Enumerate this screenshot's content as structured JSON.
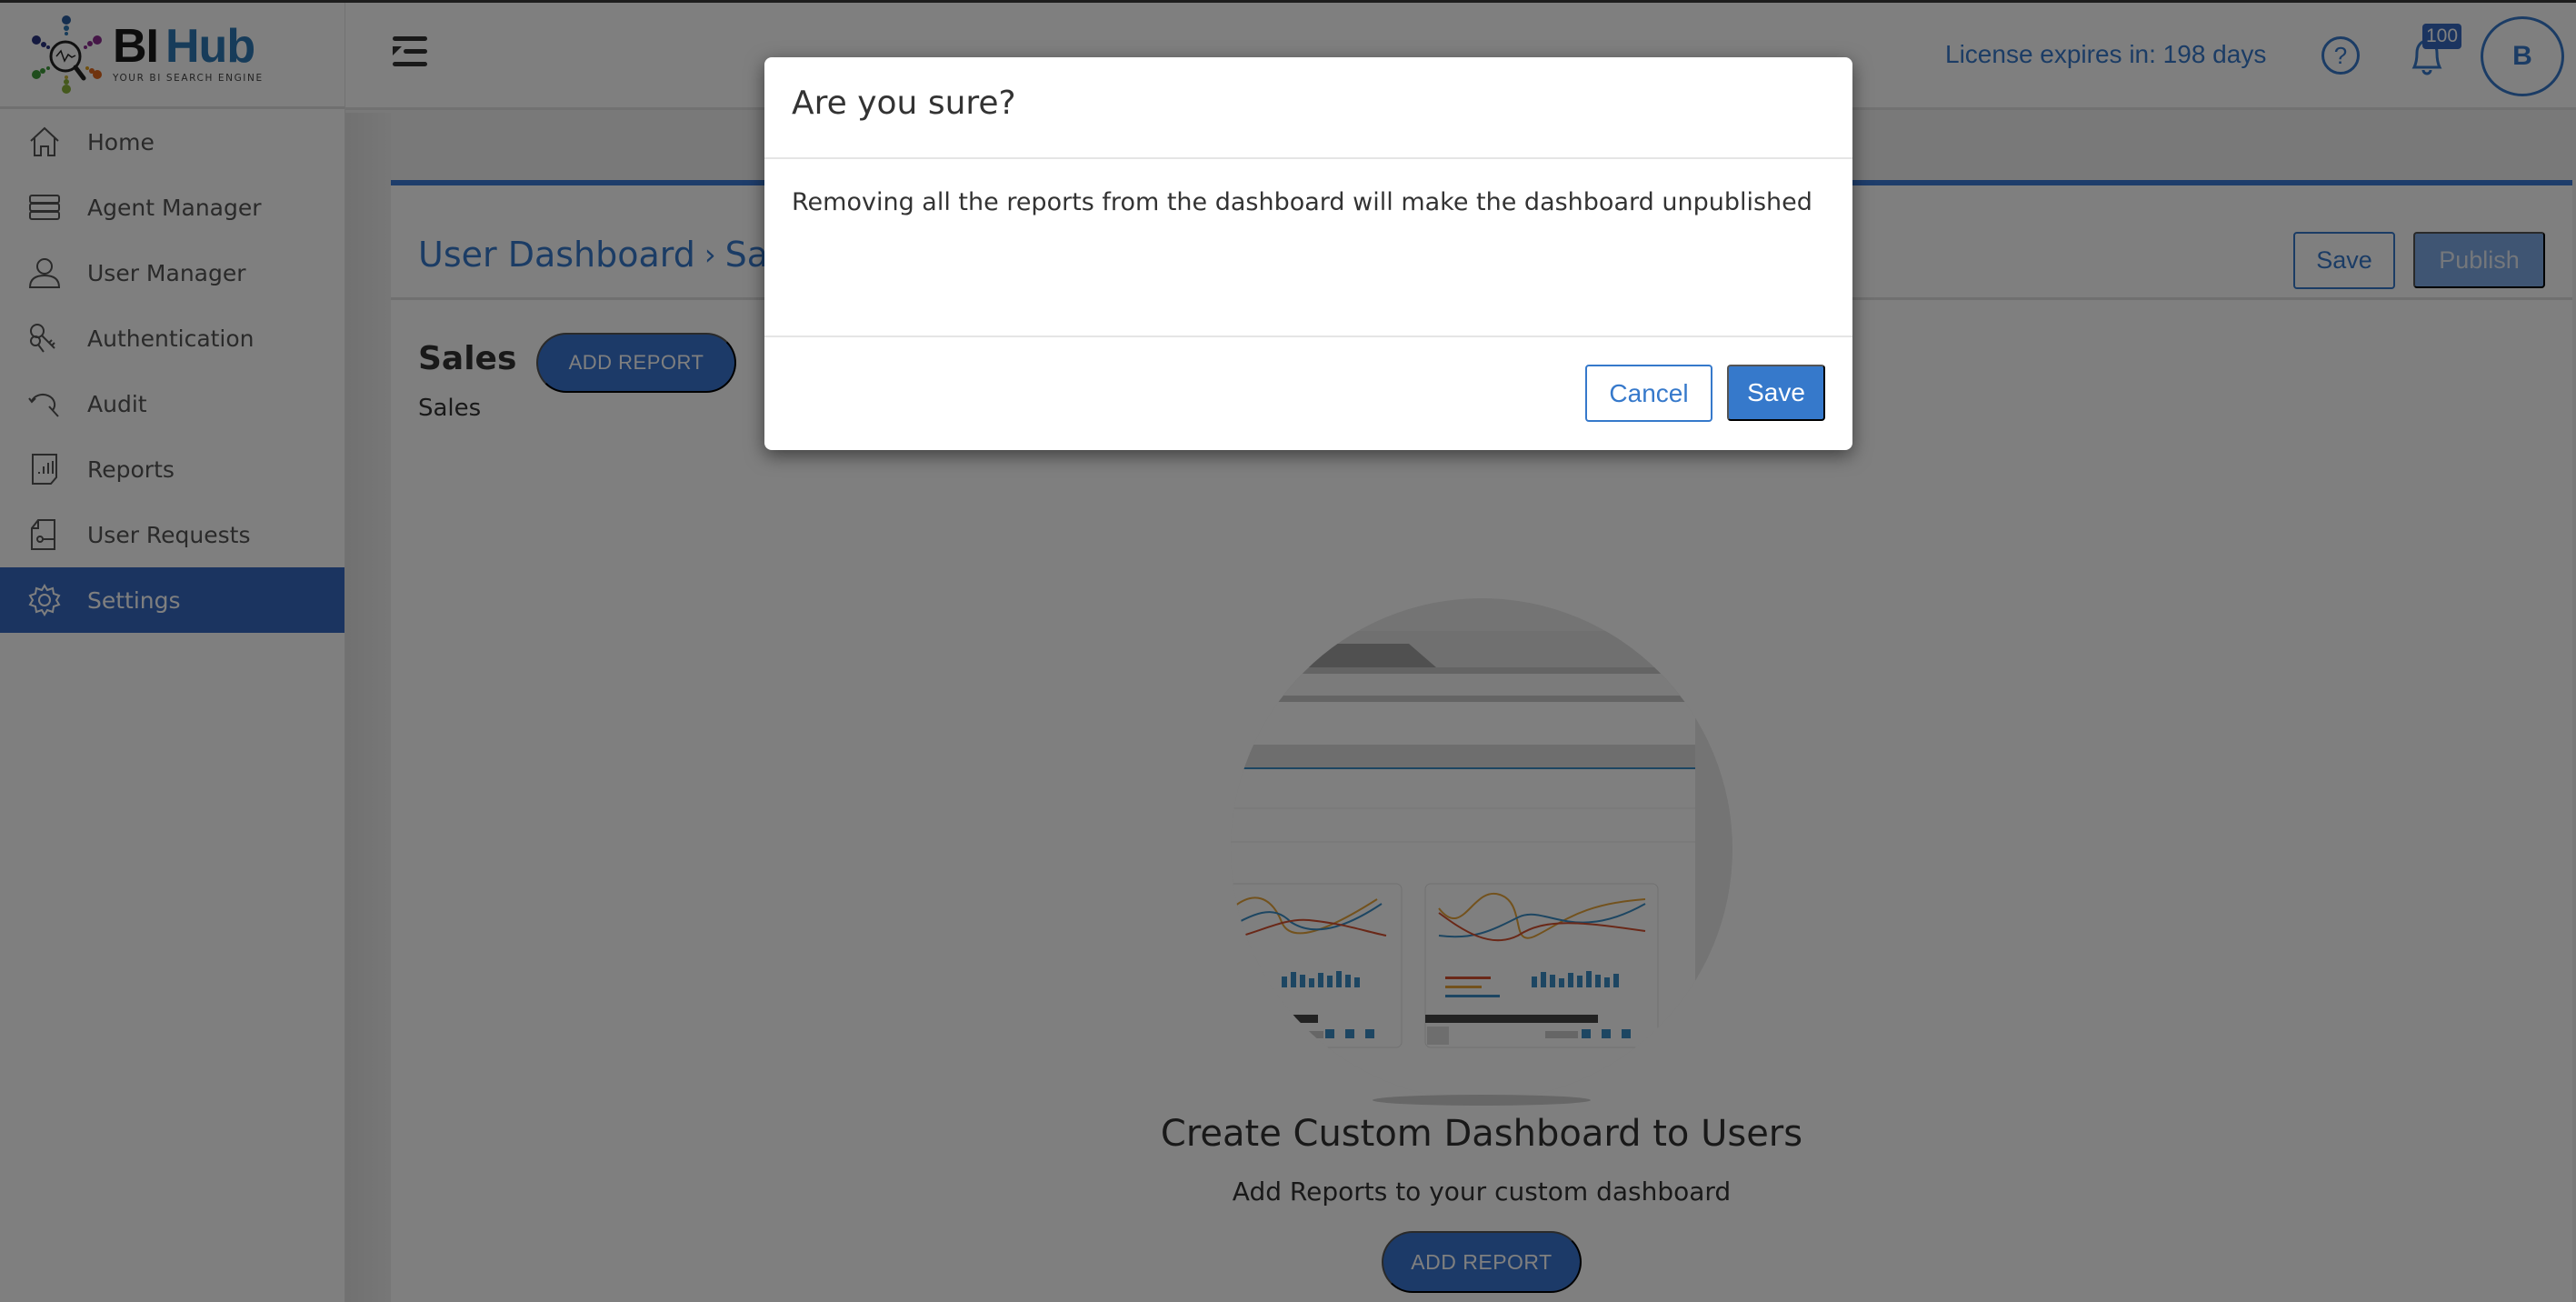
{
  "app": {
    "logo_main_left": "BI",
    "logo_main_right": "Hub",
    "logo_tagline": "YOUR BI SEARCH ENGINE"
  },
  "colors": {
    "primary": "#3679cb",
    "sidebar_active": "#3769c0",
    "overlay": "rgba(0,0,0,0.5)"
  },
  "sidebar": {
    "items": [
      {
        "label": "Home",
        "icon": "home-icon",
        "active": false
      },
      {
        "label": "Agent Manager",
        "icon": "server-icon",
        "active": false
      },
      {
        "label": "User Manager",
        "icon": "user-icon",
        "active": false
      },
      {
        "label": "Authentication",
        "icon": "keys-icon",
        "active": false
      },
      {
        "label": "Audit",
        "icon": "audit-search-icon",
        "active": false
      },
      {
        "label": "Reports",
        "icon": "report-chart-icon",
        "active": false
      },
      {
        "label": "User Requests",
        "icon": "request-key-icon",
        "active": false
      },
      {
        "label": "Settings",
        "icon": "gear-icon",
        "active": true
      }
    ]
  },
  "header": {
    "menu_icon": "menu-collapse-icon",
    "license_text": "License expires in: 198 days",
    "help_icon": "?",
    "notification_count": "100",
    "avatar_initial": "B"
  },
  "main": {
    "breadcrumb": {
      "parent": "User Dashboard",
      "separator": "›",
      "current": "Sales"
    },
    "save_label": "Save",
    "publish_label": "Publish",
    "dashboard_title": "Sales",
    "dashboard_subtitle": "Sales",
    "add_report_label": "ADD REPORT",
    "empty_state": {
      "title": "Create Custom Dashboard to Users",
      "subtitle": "Add Reports to your custom dashboard",
      "button_label": "ADD REPORT"
    }
  },
  "modal": {
    "title": "Are you sure?",
    "message": "Removing all the reports from the dashboard will make the dashboard unpublished",
    "cancel_label": "Cancel",
    "save_label": "Save"
  }
}
